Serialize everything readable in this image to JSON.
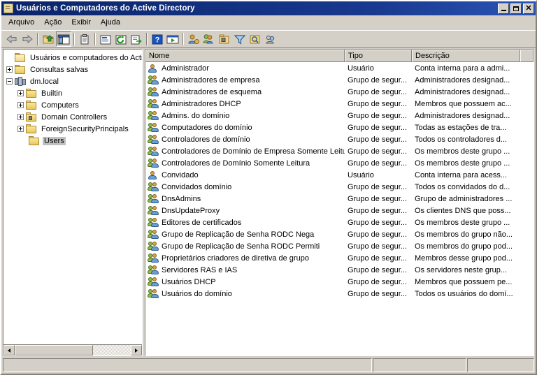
{
  "window": {
    "title": "Usuários e Computadores do Active Directory",
    "icon": "console-window-icon",
    "controls": {
      "minimize": "Minimizar",
      "maximize": "Maximizar",
      "close": "Fechar"
    }
  },
  "menu": {
    "items": [
      {
        "label": "Arquivo",
        "name": "menu-arquivo"
      },
      {
        "label": "Ação",
        "name": "menu-acao"
      },
      {
        "label": "Exibir",
        "name": "menu-exibir"
      },
      {
        "label": "Ajuda",
        "name": "menu-ajuda"
      }
    ]
  },
  "toolbar": {
    "buttons": [
      {
        "icon": "back-arrow-icon",
        "title": "Voltar"
      },
      {
        "icon": "forward-arrow-icon",
        "title": "Avançar"
      },
      {
        "icon": "up-one-level-folder-icon",
        "title": "Um nível acima"
      },
      {
        "icon": "show-hide-console-tree-icon",
        "title": "Mostrar/Ocultar árvore de console",
        "pressed": true
      },
      {
        "icon": "properties-clipboard-icon",
        "title": "Propriedades"
      },
      {
        "icon": "properties-window-icon",
        "title": "Propriedades"
      },
      {
        "icon": "refresh-icon",
        "title": "Atualizar"
      },
      {
        "icon": "export-list-icon",
        "title": "Exportar lista"
      },
      {
        "icon": "help-question-icon",
        "title": "Ajuda"
      },
      {
        "icon": "run-console-icon",
        "title": "Executar"
      },
      {
        "icon": "new-user-icon",
        "title": "Novo usuário"
      },
      {
        "icon": "new-group-icon",
        "title": "Novo grupo"
      },
      {
        "icon": "new-ou-icon",
        "title": "Nova unidade organizacional"
      },
      {
        "icon": "filter-funnel-icon",
        "title": "Filtrar"
      },
      {
        "icon": "find-icon",
        "title": "Localizar"
      },
      {
        "icon": "saved-query-icon",
        "title": "Consulta"
      }
    ]
  },
  "tree": {
    "nodes": [
      {
        "label": "Usuários e computadores do Active",
        "icon": "console-root-icon",
        "indent": 0,
        "expander": "none",
        "selected": false,
        "name": "tree-node-root"
      },
      {
        "label": "Consultas salvas",
        "icon": "folder-icon",
        "indent": 1,
        "expander": "plus",
        "selected": false,
        "name": "tree-node-consultas-salvas"
      },
      {
        "label": "dm.local",
        "icon": "domain-icon",
        "indent": 1,
        "expander": "minus",
        "selected": false,
        "name": "tree-node-dm-local"
      },
      {
        "label": "Builtin",
        "icon": "folder-icon",
        "indent": 2,
        "expander": "plus",
        "selected": false,
        "name": "tree-node-builtin"
      },
      {
        "label": "Computers",
        "icon": "folder-icon",
        "indent": 2,
        "expander": "plus",
        "selected": false,
        "name": "tree-node-computers"
      },
      {
        "label": "Domain Controllers",
        "icon": "folder-ou-icon",
        "indent": 2,
        "expander": "plus",
        "selected": false,
        "name": "tree-node-domain-controllers"
      },
      {
        "label": "ForeignSecurityPrincipals",
        "icon": "folder-icon",
        "indent": 2,
        "expander": "plus",
        "selected": false,
        "name": "tree-node-foreignsecurityprincipals"
      },
      {
        "label": "Users",
        "icon": "folder-icon",
        "indent": 2,
        "expander": "none",
        "selected": true,
        "name": "tree-node-users"
      }
    ]
  },
  "list": {
    "columns": [
      {
        "label": "Nome",
        "name": "column-header-nome"
      },
      {
        "label": "Tipo",
        "name": "column-header-tipo"
      },
      {
        "label": "Descrição",
        "name": "column-header-descricao"
      }
    ],
    "rows": [
      {
        "name": "Administrador",
        "icon": "user-icon",
        "type": "Usuário",
        "description": "Conta interna para a admi..."
      },
      {
        "name": "Administradores de empresa",
        "icon": "group-icon",
        "type": "Grupo de segur...",
        "description": "Administradores designad..."
      },
      {
        "name": "Administradores de esquema",
        "icon": "group-icon",
        "type": "Grupo de segur...",
        "description": "Administradores designad..."
      },
      {
        "name": "Administradores DHCP",
        "icon": "group-icon",
        "type": "Grupo de segur...",
        "description": "Membros que possuem ac..."
      },
      {
        "name": "Admins. do domínio",
        "icon": "group-icon",
        "type": "Grupo de segur...",
        "description": "Administradores designad..."
      },
      {
        "name": "Computadores do domínio",
        "icon": "group-icon",
        "type": "Grupo de segur...",
        "description": "Todas as estações de tra..."
      },
      {
        "name": "Controladores de domínio",
        "icon": "group-icon",
        "type": "Grupo de segur...",
        "description": "Todos os controladores d..."
      },
      {
        "name": "Controladores de Domínio de Empresa Somente Leitura",
        "icon": "group-icon",
        "type": "Grupo de segur...",
        "description": "Os membros deste grupo ..."
      },
      {
        "name": "Controladores de Domínio Somente Leitura",
        "icon": "group-icon",
        "type": "Grupo de segur...",
        "description": "Os membros deste grupo ..."
      },
      {
        "name": "Convidado",
        "icon": "user-icon",
        "type": "Usuário",
        "description": "Conta interna para acess..."
      },
      {
        "name": "Convidados domínio",
        "icon": "group-icon",
        "type": "Grupo de segur...",
        "description": "Todos os convidados do d..."
      },
      {
        "name": "DnsAdmins",
        "icon": "group-icon",
        "type": "Grupo de segur...",
        "description": "Grupo de administradores ..."
      },
      {
        "name": "DnsUpdateProxy",
        "icon": "group-icon",
        "type": "Grupo de segur...",
        "description": "Os clientes DNS que poss..."
      },
      {
        "name": "Editores de certificados",
        "icon": "group-icon",
        "type": "Grupo de segur...",
        "description": "Os membros deste grupo ..."
      },
      {
        "name": "Grupo de Replicação de Senha RODC Nega",
        "icon": "group-icon",
        "type": "Grupo de segur...",
        "description": "Os membros do grupo não..."
      },
      {
        "name": "Grupo de Replicação de Senha RODC Permiti",
        "icon": "group-icon",
        "type": "Grupo de segur...",
        "description": "Os membros do grupo pod..."
      },
      {
        "name": "Proprietários criadores de diretiva de grupo",
        "icon": "group-icon",
        "type": "Grupo de segur...",
        "description": "Membros desse grupo pod..."
      },
      {
        "name": "Servidores RAS e IAS",
        "icon": "group-icon",
        "type": "Grupo de segur...",
        "description": "Os servidores neste grup..."
      },
      {
        "name": "Usuários DHCP",
        "icon": "group-icon",
        "type": "Grupo de segur...",
        "description": "Membros que possuem pe..."
      },
      {
        "name": "Usuários do domínio",
        "icon": "group-icon",
        "type": "Grupo de segur...",
        "description": "Todos os usuários do domí..."
      }
    ]
  },
  "scrollbar": {
    "left_arrow": "scroll-left-arrow",
    "right_arrow": "scroll-right-arrow"
  },
  "statusbar": {
    "pane1": "",
    "pane2": "",
    "pane3": ""
  },
  "colors": {
    "titlebar_start": "#0a246a",
    "titlebar_end": "#2a55b5",
    "window_face": "#d4d0c8",
    "selection_inactive": "#c0c0c0",
    "list_background": "#ffffff"
  }
}
